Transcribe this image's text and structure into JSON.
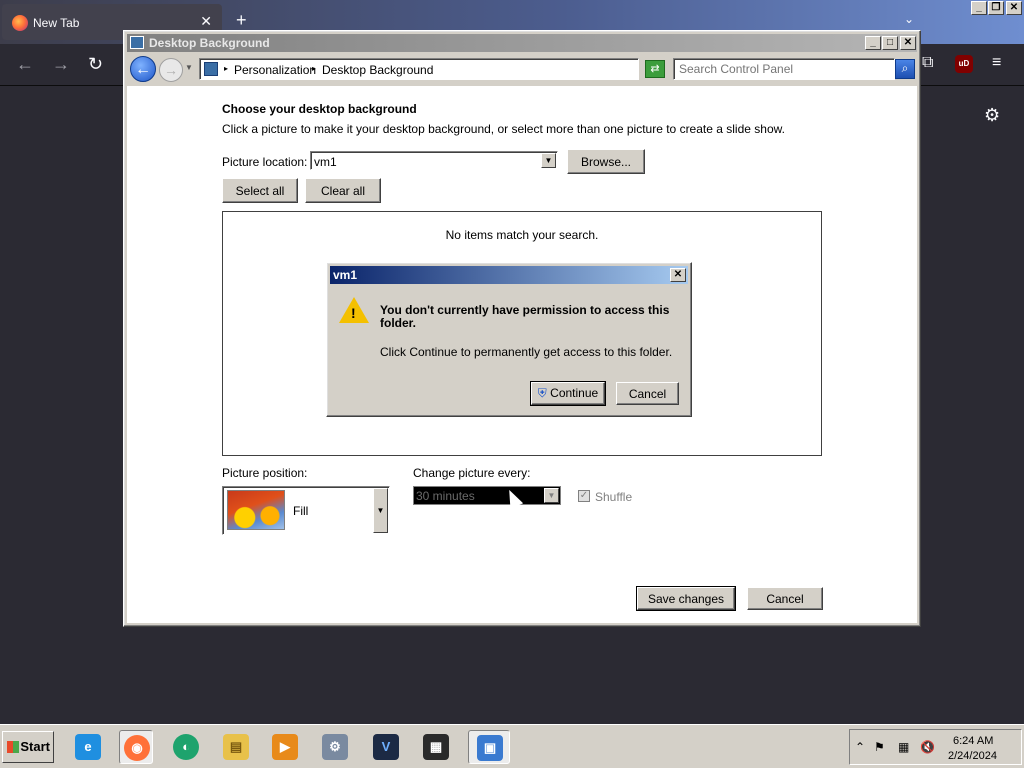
{
  "browser": {
    "tab_title": "New Tab",
    "tab_close": "✕",
    "new_tab": "+",
    "list_tabs": "⌄",
    "back": "←",
    "forward": "→",
    "reload": "↻",
    "extensions": "⧉",
    "ublock": "uD",
    "menu": "≡",
    "settings": "⚙",
    "outer_controls": {
      "minimize": "_",
      "restore": "❐",
      "close": "✕"
    }
  },
  "window": {
    "title": "Desktop Background",
    "controls": {
      "minimize": "_",
      "maximize": "□",
      "close": "✕"
    },
    "breadcrumb": [
      "Personalization",
      "Desktop Background"
    ],
    "breadcrumb_separator": "▸",
    "search_placeholder": "Search Control Panel",
    "back_glyph": "←",
    "forward_glyph": "→",
    "dropdown_glyph": "▼",
    "refresh_glyph": "⇄",
    "search_glyph": "⌕"
  },
  "content": {
    "heading": "Choose your desktop background",
    "subheading": "Click a picture to make it your desktop background, or select more than one picture to create a slide show.",
    "picture_location_label": "Picture location:",
    "picture_location_value": "vm1",
    "browse_button": "Browse...",
    "select_all_button": "Select all",
    "clear_all_button": "Clear all",
    "empty_message": "No items match your search.",
    "picture_position_label": "Picture position:",
    "picture_position_value": "Fill",
    "change_picture_label": "Change picture every:",
    "change_picture_value": "30 minutes",
    "shuffle_label": "Shuffle",
    "shuffle_check": "✓",
    "save_button": "Save changes",
    "cancel_button": "Cancel"
  },
  "dialog": {
    "title": "vm1",
    "close": "✕",
    "warning_mark": "!",
    "heading": "You don't currently have permission to access this folder.",
    "body": "Click Continue to permanently get access to this folder.",
    "continue_button": "Continue",
    "cancel_button": "Cancel",
    "shield_glyph": "⛨"
  },
  "taskbar": {
    "start_label": "Start",
    "apps": [
      {
        "name": "internet-explorer",
        "glyph": "e",
        "color": "#1f8fe0"
      },
      {
        "name": "firefox",
        "glyph": "◉",
        "color": "#ff7139"
      },
      {
        "name": "chat",
        "glyph": "◐",
        "color": "#1ea36d"
      },
      {
        "name": "file-explorer",
        "glyph": "▤",
        "color": "#e8c14a"
      },
      {
        "name": "media-player",
        "glyph": "▶",
        "color": "#e88a1a"
      },
      {
        "name": "control-panel",
        "glyph": "⚙",
        "color": "#7a8aa0"
      },
      {
        "name": "visual-studio",
        "glyph": "V",
        "color": "#1c2a44"
      },
      {
        "name": "video-editor",
        "glyph": "▦",
        "color": "#2a2a2a"
      },
      {
        "name": "display-settings",
        "glyph": "▣",
        "color": "#3a7ad0"
      }
    ],
    "tray_icons": {
      "expand": "⌃",
      "flag": "⚑",
      "network": "▦",
      "volume": "🔇"
    },
    "clock_time": "6:24 AM",
    "clock_date": "2/24/2024"
  }
}
